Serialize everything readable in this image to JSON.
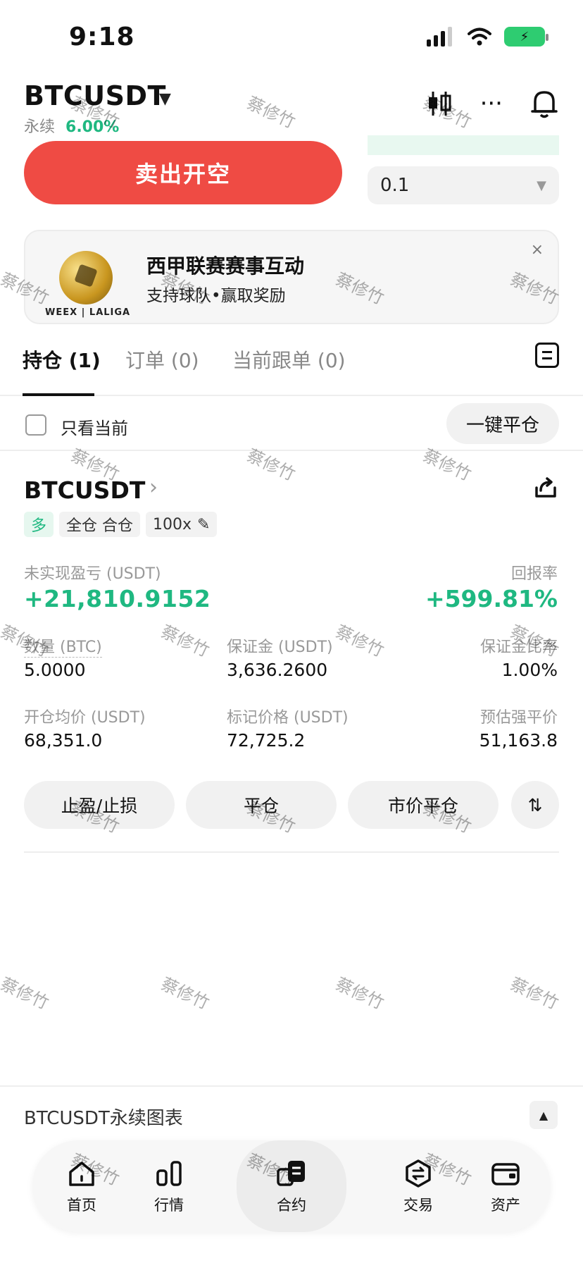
{
  "status_bar": {
    "time": "9:18"
  },
  "header": {
    "pair": "BTCUSDT",
    "perp_label": "永续",
    "perp_rate": "6.00%"
  },
  "order": {
    "sell_button": "卖出开空",
    "quantity": "0.1"
  },
  "banner": {
    "title": "西甲联赛赛事互动",
    "subtitle": "支持球队•赢取奖励",
    "brand": "WEEX | LALIGA",
    "close": "×"
  },
  "tabs": [
    {
      "label": "持仓 (1)"
    },
    {
      "label": "订单 (0)"
    },
    {
      "label": "当前跟单 (0)"
    }
  ],
  "filter": {
    "label": "只看当前",
    "close_all": "一键平仓"
  },
  "position": {
    "symbol": "BTCUSDT",
    "side_tag": "多",
    "mode_tag": "全仓 合仓",
    "leverage_tag": "100x",
    "pnl_label": "未实现盈亏 (USDT)",
    "pnl_value": "+21,810.9152",
    "roe_label": "回报率",
    "roe_value": "+599.81%",
    "qty_label": "数量 (BTC)",
    "qty_value": "5.0000",
    "margin_label": "保证金 (USDT)",
    "margin_value": "3,636.2600",
    "margin_ratio_label": "保证金比率",
    "margin_ratio_value": "1.00%",
    "entry_label": "开仓均价 (USDT)",
    "entry_value": "68,351.0",
    "mark_label": "标记价格 (USDT)",
    "mark_value": "72,725.2",
    "liq_label": "预估强平价",
    "liq_value": "51,163.8",
    "actions": {
      "tpsl": "止盈/止损",
      "close": "平仓",
      "market_close": "市价平仓"
    }
  },
  "chart_bar": {
    "label": "BTCUSDT永续图表"
  },
  "bottom_nav": [
    {
      "label": "首页"
    },
    {
      "label": "行情"
    },
    {
      "label": "合约"
    },
    {
      "label": "交易"
    },
    {
      "label": "资产"
    }
  ],
  "watermark": "蔡修竹",
  "colors": {
    "green": "#1fb881",
    "red": "#ef4b44"
  }
}
